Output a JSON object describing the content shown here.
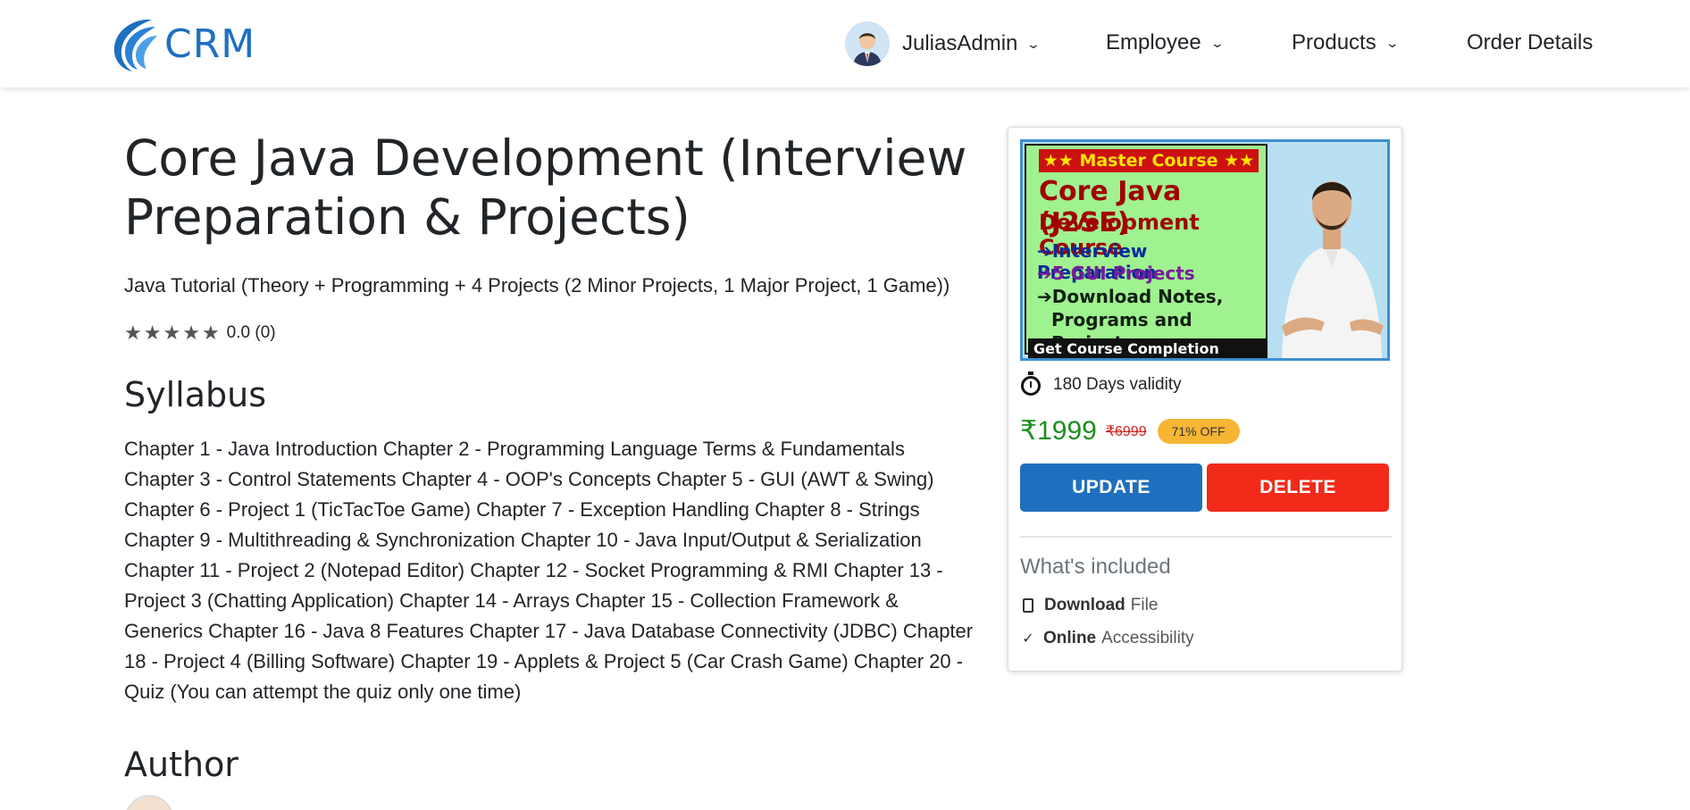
{
  "brand": {
    "text": "CRM"
  },
  "nav": {
    "user": "JuliasAdmin",
    "employee": "Employee",
    "products": "Products",
    "orders": "Order Details"
  },
  "course": {
    "title": "Core Java Development (Interview Preparation & Projects)",
    "subtitle": "Java Tutorial (Theory + Programming + 4 Projects (2 Minor Projects, 1 Major Project, 1 Game))",
    "rating_text": "0.0 (0)",
    "syllabus_heading": "Syllabus",
    "syllabus": "Chapter 1 - Java Introduction Chapter 2 - Programming Language Terms & Fundamentals Chapter 3 - Control Statements Chapter 4 - OOP's Concepts Chapter 5 - GUI (AWT & Swing) Chapter 6 - Project 1 (TicTacToe Game) Chapter 7 - Exception Handling Chapter 8 - Strings Chapter 9 - Multithreading & Synchronization Chapter 10 - Java Input/Output & Serialization Chapter 11 - Project 2 (Notepad Editor) Chapter 12 - Socket Programming & RMI Chapter 13 - Project 3 (Chatting Application) Chapter 14 - Arrays Chapter 15 - Collection Framework & Generics Chapter 16 - Java 8 Features Chapter 17 - Java Database Connectivity (JDBC) Chapter 18 - Project 4 (Billing Software) Chapter 19 - Applets & Project 5 (Car Crash Game) Chapter 20 - Quiz (You can attempt the quiz only one time)",
    "author_heading": "Author"
  },
  "card": {
    "thumb": {
      "banner": "★★ Master Course ★★",
      "line1": "Core Java (J2SE)",
      "line2": "Development Course",
      "line3": "➔Interview Preparation",
      "line4": "➔5 GUI Projects",
      "line5a": "➔Download Notes,",
      "line5b": "Programs and Projects",
      "certificate": "Get Course Completion Certificate"
    },
    "validity": "180 Days validity",
    "price": "₹1999",
    "old_price": "₹6999",
    "discount": "71% OFF",
    "update_label": "UPDATE",
    "delete_label": "DELETE",
    "included_heading": "What's included",
    "included": [
      {
        "bold": "Download",
        "rest": "File"
      },
      {
        "bold": "Online",
        "rest": "Accessibility"
      }
    ]
  },
  "colors": {
    "brand_blue": "#1f6fbf",
    "delete_red": "#f22a1a",
    "price_green": "#1e8e1e",
    "discount_badge": "#f7b534"
  }
}
